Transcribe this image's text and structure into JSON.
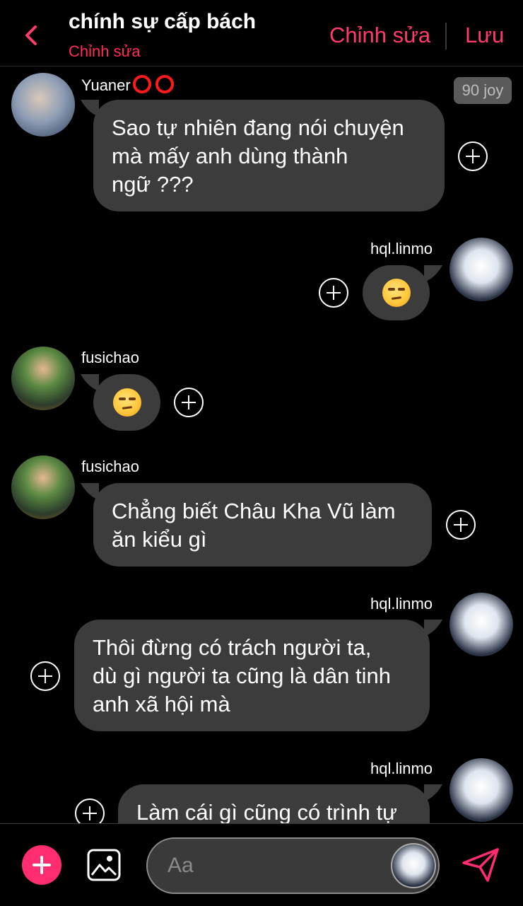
{
  "header": {
    "title": "chính sự cấp bách",
    "subtitle": "Chỉnh sửa",
    "edit_label": "Chỉnh sửa",
    "save_label": "Lưu",
    "accent": "#ff3b6b"
  },
  "messages": [
    {
      "sender": "Yuaner",
      "side": "left",
      "text": "Sao tự nhiên đang nói chuyện\nmà mấy anh dùng thành\nngữ ???",
      "badge": "90 joy"
    },
    {
      "sender": "hql.linmo",
      "side": "right",
      "emoji": "unamused-face"
    },
    {
      "sender": "fusichao",
      "side": "left",
      "emoji": "unamused-face"
    },
    {
      "sender": "fusichao",
      "side": "left",
      "text": "Chẳng biết Châu Kha Vũ làm\năn kiểu gì"
    },
    {
      "sender": "hql.linmo",
      "side": "right",
      "text": "Thôi đừng có trách người ta,\ndù gì người ta cũng là dân tinh\nanh xã hội mà"
    },
    {
      "sender": "hql.linmo",
      "side": "right",
      "text": "Làm cái gì cũng có trình tự"
    }
  ],
  "composer": {
    "placeholder": "Aa",
    "icons": [
      "plus-icon",
      "image-icon",
      "send-icon"
    ]
  },
  "colors": {
    "bubble": "#3c3c3c",
    "background": "#000000",
    "add_button": "#ff2d6f"
  }
}
